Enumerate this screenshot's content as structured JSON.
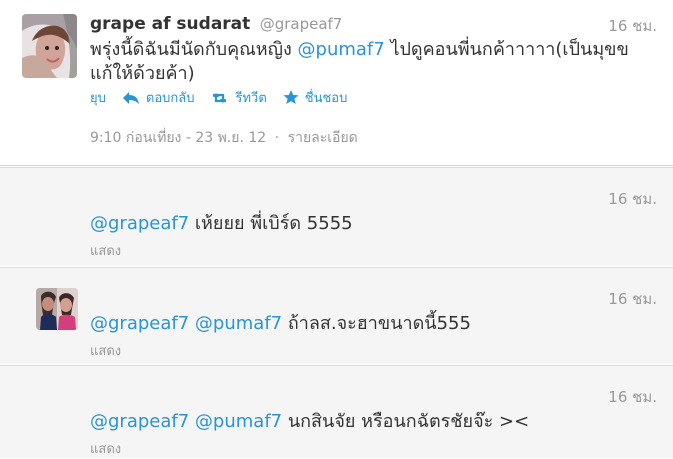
{
  "main_tweet": {
    "display_name": "grape af sudarat",
    "screen_name": "@grapeaf7",
    "time": "16 ชม.",
    "text_parts": [
      "พรุ่งนี้ดิฉันมีนัดกับคุณหญิง ",
      "@pumaf7",
      " ไปดูคอนพี่นกค้าาาาา(เป็นมุขขแก้ให้ด้วยค้า)"
    ],
    "actions": {
      "collapse": "ยุบ",
      "reply": "ตอบกลับ",
      "retweet": "รีทวีต",
      "favorite": "ชื่นชอบ"
    },
    "meta": {
      "timestamp": "9:10 ก่อนเที่ยง - 23 พ.ย. 12",
      "separator": "·",
      "details": "รายละเอียด"
    }
  },
  "replies": [
    {
      "time": "16 ชม.",
      "mentions": [
        "@grapeaf7"
      ],
      "text": " เห้ยยย พี่เบิร์ด 5555",
      "show": "แสดง"
    },
    {
      "time": "16 ชม.",
      "mentions": [
        "@grapeaf7",
        "@pumaf7"
      ],
      "text": " ถ้าลส.จะฮาขนาดนี้555",
      "show": "แสดง"
    },
    {
      "time": "16 ชม.",
      "mentions": [
        "@grapeaf7",
        "@pumaf7"
      ],
      "text": " นกสินจัย หรือนกฉัตรชัยจ๊ะ ><",
      "show": "แสดง"
    }
  ]
}
